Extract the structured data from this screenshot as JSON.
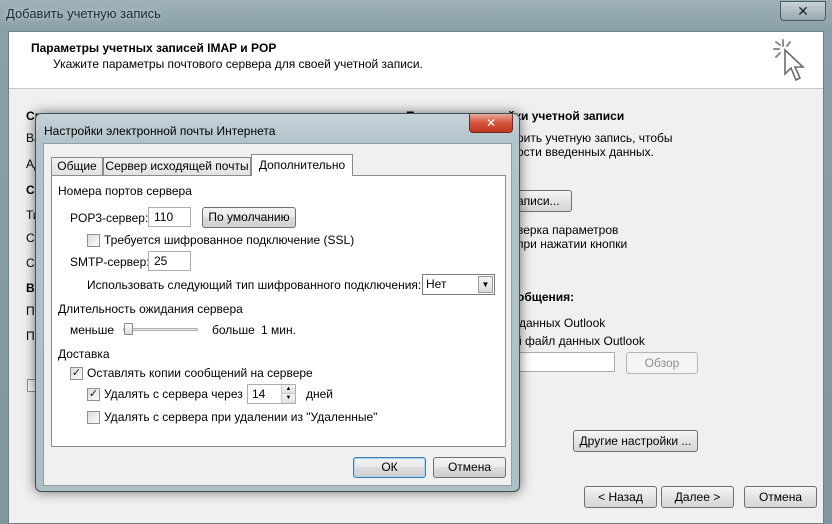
{
  "outer_window": {
    "title": "Добавить учетную запись",
    "close_glyph": "✕",
    "header_title": "Параметры учетных записей IMAP и POP",
    "header_subtitle": "Укажите параметры почтового сервера для своей учетной записи.",
    "left": {
      "section_user": "Сведения о пользователе",
      "label_fragments": [
        "Ва",
        "Ад",
        "Св",
        "Ти",
        "Се",
        "Се",
        "Вх",
        "По",
        "Па"
      ]
    },
    "right": {
      "section_check": "Проверка настройки учетной записи",
      "check_text_1": "рить учетную запись, чтобы",
      "check_text_2": "ости введенных данных.",
      "check_button": "записи...",
      "auto_text_1": "верка параметров",
      "auto_text_2": "при нажатии кнопки",
      "deliver_heading": "общения:",
      "new_data_file": "данных Outlook",
      "existing_data_file": "й файл данных Outlook",
      "browse_button": "Обзор",
      "more_settings_button": "Другие настройки ..."
    },
    "footer": {
      "back": "< Назад",
      "next": "Далее >",
      "cancel": "Отмена"
    }
  },
  "dialog": {
    "title": "Настройки электронной почты Интернета",
    "close_glyph": "✕",
    "tabs": [
      {
        "label": "Общие"
      },
      {
        "label": "Сервер исходящей почты"
      },
      {
        "label": "Дополнительно",
        "active": true
      }
    ],
    "ports": {
      "group": "Номера портов сервера",
      "pop3_label": "POP3-сервер:",
      "pop3_value": "110",
      "default_button": "По умолчанию",
      "ssl_label": "Требуется шифрованное подключение (SSL)",
      "ssl_checked": false,
      "smtp_label": "SMTP-сервер:",
      "smtp_value": "25",
      "enc_label": "Использовать следующий тип шифрованного подключения:",
      "enc_value": "Нет"
    },
    "timeout": {
      "group": "Длительность ожидания сервера",
      "less": "меньше",
      "more": "больше",
      "value": "1 мин.",
      "level": 0.08
    },
    "delivery": {
      "group": "Доставка",
      "keep_copies": "Оставлять копии сообщений на сервере",
      "keep_checked": true,
      "remove_after": "Удалять с сервера через",
      "remove_after_checked": true,
      "days_value": "14",
      "days_label": "дней",
      "remove_deleted": "Удалять с сервера при удалении из \"Удаленные\"",
      "remove_deleted_checked": false
    },
    "ok": "ОК",
    "cancel": "Отмена"
  }
}
